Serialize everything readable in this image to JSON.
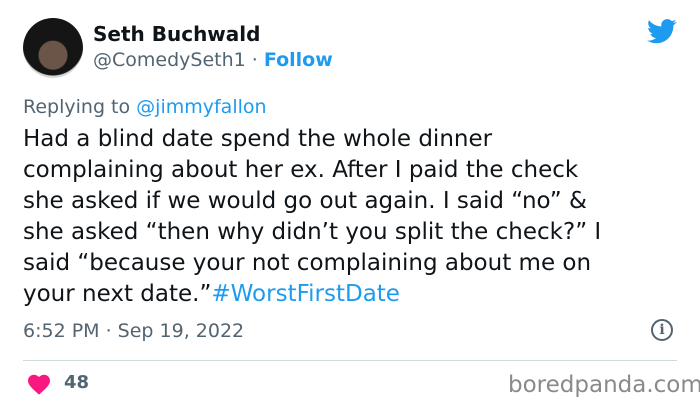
{
  "author": {
    "name": "Seth Buchwald",
    "handle": "@ComedySeth1",
    "separator": "·",
    "follow_label": "Follow"
  },
  "reply": {
    "prefix": "Replying to",
    "mention": "@jimmyfallon"
  },
  "tweet": {
    "body": "Had a blind date spend the whole dinner\ncomplaining about her ex. After I paid the check\nshe asked if we would go out again. I said “no” &\nshe asked “then why didn’t you split the check?” I\nsaid “because your not complaining about me on\nyour next date.”",
    "hashtag": "#WorstFirstDate",
    "timestamp": "6:52 PM · Sep 19, 2022",
    "like_count": "48"
  },
  "icons": {
    "brand": "twitter-bird-icon",
    "info": "info-icon",
    "like": "heart-icon"
  },
  "colors": {
    "link": "#1d9bf0",
    "heart": "#f91880",
    "muted": "#536471"
  },
  "watermark": "boredpanda.com"
}
